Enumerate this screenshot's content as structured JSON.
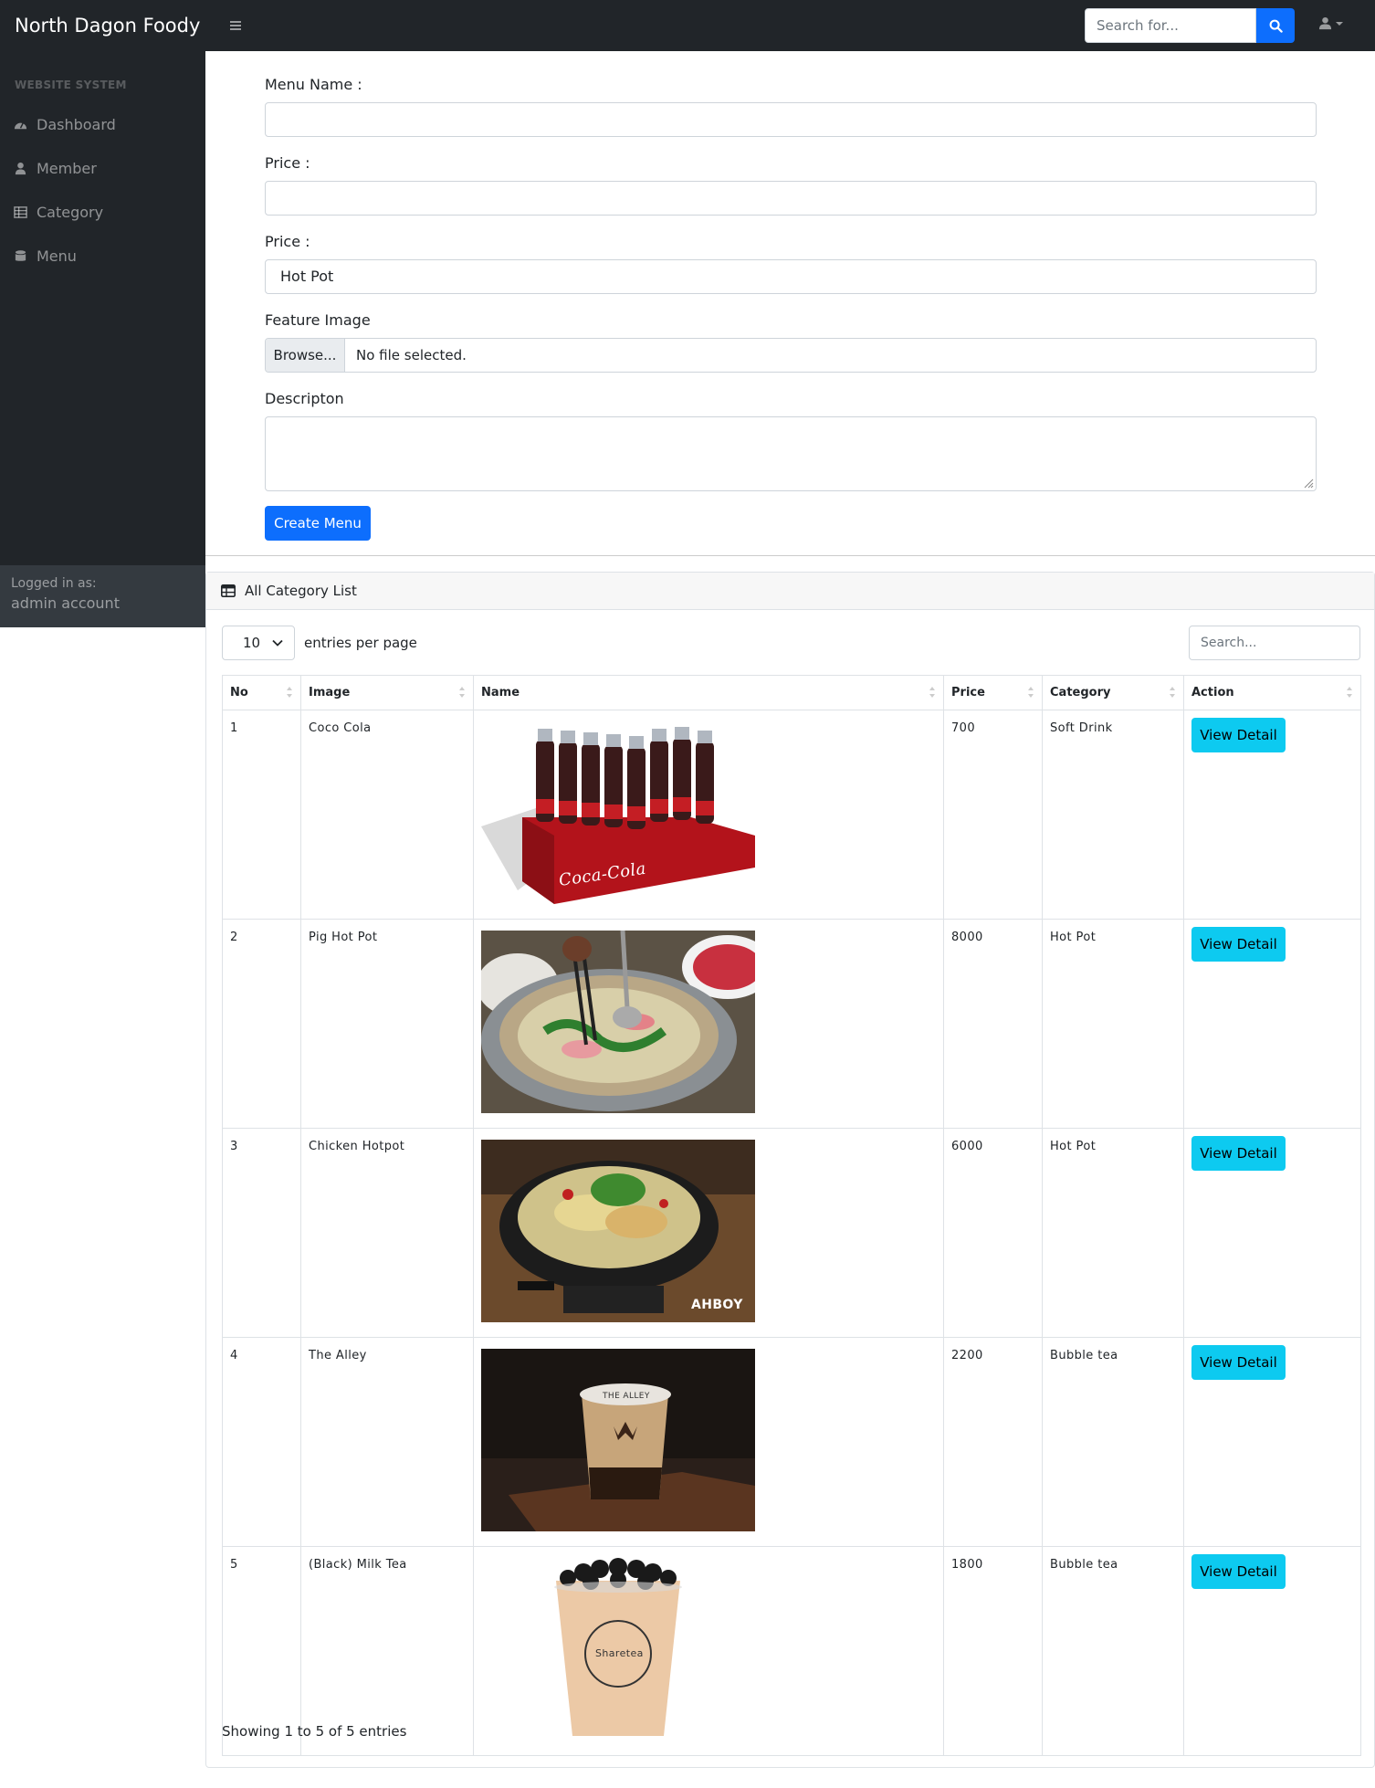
{
  "brand": "North Dagon Foody",
  "topbar": {
    "search_placeholder": "Search for..."
  },
  "sidebar": {
    "heading": "WEBSITE SYSTEM",
    "items": [
      {
        "label": "Dashboard",
        "icon": "dashboard-icon"
      },
      {
        "label": "Member",
        "icon": "user-icon"
      },
      {
        "label": "Category",
        "icon": "table-icon"
      },
      {
        "label": "Menu",
        "icon": "database-icon"
      }
    ],
    "footer_label": "Logged in as:",
    "footer_user": "admin account"
  },
  "form": {
    "menu_name_label": "Menu Name :",
    "menu_name_value": "",
    "price_label": "Price :",
    "price_value": "",
    "category_label": "Price :",
    "category_value": "Hot Pot",
    "image_label": "Feature Image",
    "browse_label": "Browse...",
    "file_status": "No file selected.",
    "description_label": "Descripton",
    "description_value": "",
    "submit_label": "Create Menu"
  },
  "table": {
    "title": "All Category List",
    "per_page_value": "10",
    "per_page_label": "entries per page",
    "search_placeholder": "Search...",
    "columns": [
      "No",
      "Image",
      "Name",
      "Price",
      "Category",
      "Action"
    ],
    "rows": [
      {
        "no": "1",
        "image": "Coco Cola",
        "price": "700",
        "category": "Soft Drink",
        "action": "View Detail"
      },
      {
        "no": "2",
        "image": "Pig Hot Pot",
        "price": "8000",
        "category": "Hot Pot",
        "action": "View Detail"
      },
      {
        "no": "3",
        "image": "Chicken Hotpot",
        "price": "6000",
        "category": "Hot Pot",
        "action": "View Detail"
      },
      {
        "no": "4",
        "image": "The Alley",
        "price": "2200",
        "category": "Bubble tea",
        "action": "View Detail"
      },
      {
        "no": "5",
        "image": "(Black) Milk Tea",
        "price": "1800",
        "category": "Bubble tea",
        "action": "View Detail"
      }
    ],
    "photo_texts": {
      "coke": "Coca-Cola",
      "chicken": "AHBOY",
      "alley": "THE ALLEY",
      "milktea": "Sharetea"
    },
    "footer": "Showing 1 to 5 of 5 entries"
  },
  "colors": {
    "dark": "#212529",
    "primary": "#0d6efd",
    "info": "#0dcaf0"
  }
}
